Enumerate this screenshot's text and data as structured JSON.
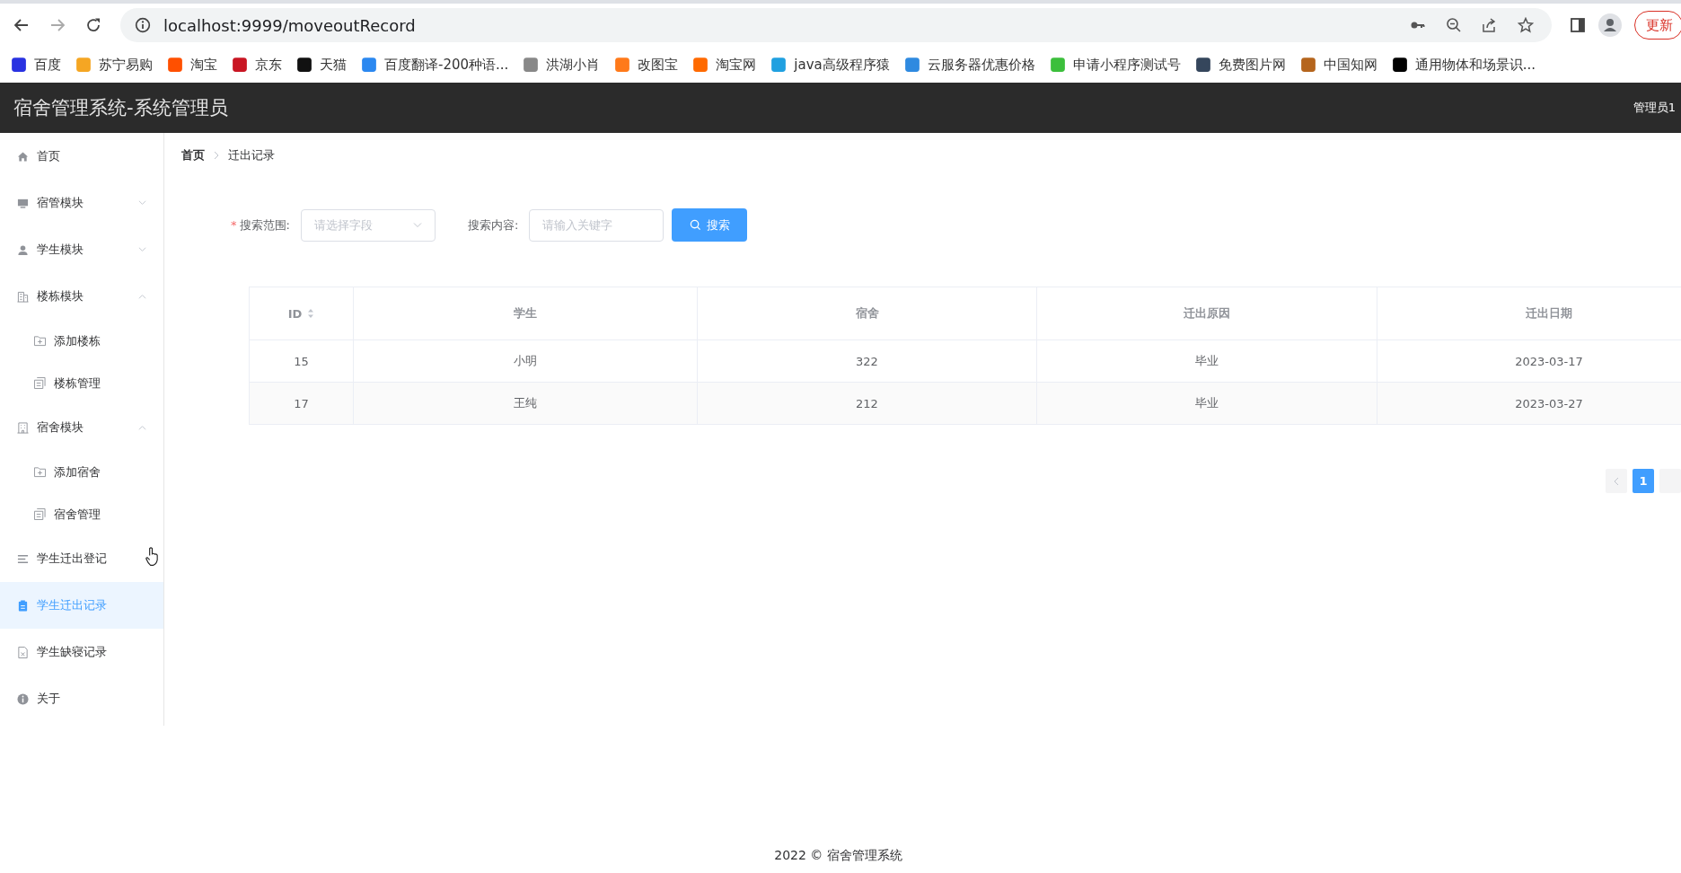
{
  "browser": {
    "url": "localhost:9999/moveoutRecord",
    "update_button": "更新"
  },
  "bookmarks": [
    {
      "label": "百度",
      "color": "#2932e1"
    },
    {
      "label": "苏宁易购",
      "color": "#f5a623"
    },
    {
      "label": "淘宝",
      "color": "#ff5000"
    },
    {
      "label": "京东",
      "color": "#c91623"
    },
    {
      "label": "天猫",
      "color": "#111111"
    },
    {
      "label": "百度翻译-200种语...",
      "color": "#2b88f0"
    },
    {
      "label": "洪湖小肖",
      "color": "#888888"
    },
    {
      "label": "改图宝",
      "color": "#ff7a1a"
    },
    {
      "label": "淘宝网",
      "color": "#ff6a00"
    },
    {
      "label": "java高级程序猿",
      "color": "#20a0e0"
    },
    {
      "label": "云服务器优惠价格",
      "color": "#2f8ae0"
    },
    {
      "label": "申请小程序测试号",
      "color": "#3cbf3c"
    },
    {
      "label": "免费图片网",
      "color": "#35465c"
    },
    {
      "label": "中国知网",
      "color": "#b5651d"
    },
    {
      "label": "通用物体和场景识...",
      "color": "#000000"
    }
  ],
  "header": {
    "title": "宿舍管理系统-系统管理员",
    "user": "管理员1"
  },
  "sidebar": {
    "items": [
      {
        "label": "首页",
        "selected": false
      },
      {
        "label": "宿管模块",
        "selected": false,
        "expanded": false
      },
      {
        "label": "学生模块",
        "selected": false,
        "expanded": false
      },
      {
        "label": "楼栋模块",
        "selected": false,
        "expanded": true,
        "children": [
          {
            "label": "添加楼栋",
            "selected": false
          },
          {
            "label": "楼栋管理",
            "selected": false
          }
        ]
      },
      {
        "label": "宿舍模块",
        "selected": false,
        "expanded": true,
        "children": [
          {
            "label": "添加宿舍",
            "selected": false
          },
          {
            "label": "宿舍管理",
            "selected": false
          }
        ]
      },
      {
        "label": "学生迁出登记",
        "selected": false
      },
      {
        "label": "学生迁出记录",
        "selected": true
      },
      {
        "label": "学生缺寝记录",
        "selected": false
      },
      {
        "label": "关于",
        "selected": false
      }
    ]
  },
  "breadcrumb": [
    "首页",
    "迁出记录"
  ],
  "search": {
    "range_label": "搜索范围:",
    "required_mark": "*",
    "range_placeholder": "请选择字段",
    "content_label": "搜索内容:",
    "content_placeholder": "请输入关键字",
    "button": "搜索"
  },
  "table": {
    "columns": [
      {
        "label": "ID",
        "sortable": true
      },
      {
        "label": "学生",
        "sortable": false
      },
      {
        "label": "宿舍",
        "sortable": false
      },
      {
        "label": "迁出原因",
        "sortable": false
      },
      {
        "label": "迁出日期",
        "sortable": false
      }
    ],
    "rows": [
      [
        "15",
        "小明",
        "322",
        "毕业",
        "2023-03-17"
      ],
      [
        "17",
        "王纯",
        "212",
        "毕业",
        "2023-03-27"
      ]
    ]
  },
  "pagination": {
    "pages": [
      {
        "label": "1",
        "selected": true
      }
    ]
  },
  "footer": "2022 © 宿舍管理系统"
}
